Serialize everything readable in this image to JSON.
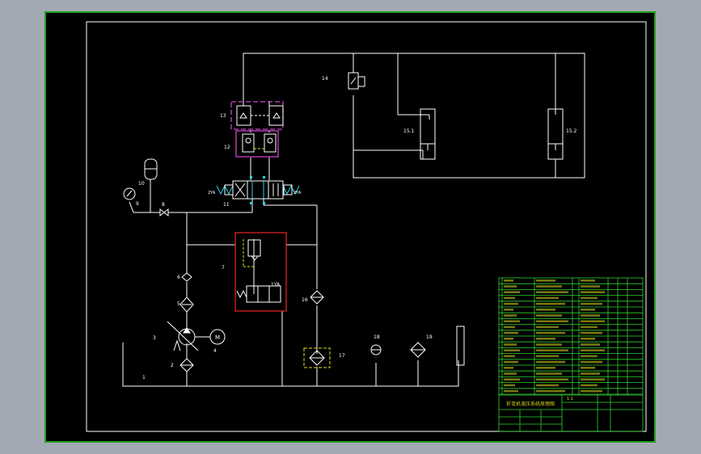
{
  "colors": {
    "background": "#000000",
    "outer_frame": "#2fd12f",
    "line": "#ffffff",
    "table": "#2fd12f",
    "table_text": "#d8d820",
    "module_13": "#cc44cc",
    "module_12": "#cc44cc",
    "module_7": "#dd2222",
    "ports": "#22d8e8",
    "filter_17": "#e0e020"
  },
  "components": {
    "c1": "1",
    "c2": "2",
    "c3": "3",
    "c4": "4",
    "c5": "5",
    "c6": "6",
    "c7": "7",
    "c8": "8",
    "c9": "9",
    "c10": "10",
    "c11": "11",
    "c12": "12",
    "c13": "13",
    "c14": "14",
    "c15_1": "15.1",
    "c15_2": "15.2",
    "c16": "16",
    "c17": "17",
    "c18": "18",
    "c19": "19",
    "motor": "M",
    "solenoid_1ya": "1YA",
    "solenoid_2ya_left": "2YA",
    "solenoid_2ya_right": "2YA"
  },
  "title_block": {
    "drawing_title": "折弯机液压系统原理图",
    "scale": "1:1"
  }
}
